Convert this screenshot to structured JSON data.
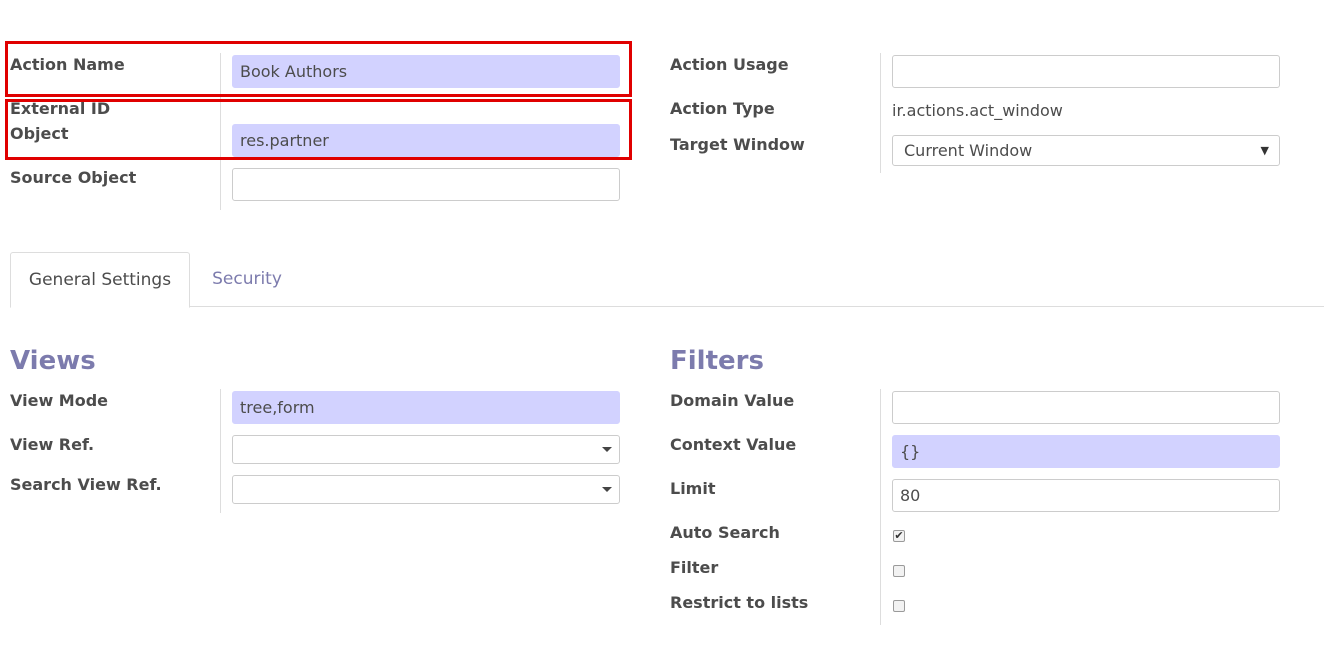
{
  "left_form": {
    "action_name_label": "Action Name",
    "action_name_value": "Book Authors",
    "external_id_label": "External ID",
    "object_label": "Object",
    "object_value": "res.partner",
    "source_object_label": "Source Object",
    "source_object_value": ""
  },
  "right_form": {
    "action_usage_label": "Action Usage",
    "action_usage_value": "",
    "action_type_label": "Action Type",
    "action_type_value": "ir.actions.act_window",
    "target_window_label": "Target Window",
    "target_window_value": "Current Window",
    "target_window_caret": "▼"
  },
  "tabs": [
    {
      "label": "General Settings",
      "active": true
    },
    {
      "label": "Security",
      "active": false
    }
  ],
  "views": {
    "title": "Views",
    "view_mode_label": "View Mode",
    "view_mode_value": "tree,form",
    "view_ref_label": "View Ref.",
    "view_ref_value": "",
    "search_view_ref_label": "Search View Ref.",
    "search_view_ref_value": ""
  },
  "filters": {
    "title": "Filters",
    "domain_value_label": "Domain Value",
    "domain_value": "",
    "context_value_label": "Context Value",
    "context_value": "{}",
    "limit_label": "Limit",
    "limit_value": "80",
    "auto_search_label": "Auto Search",
    "auto_search_checked": true,
    "auto_search_mark": "✔",
    "filter_label": "Filter",
    "filter_checked": false,
    "restrict_label": "Restrict to lists",
    "restrict_checked": false
  },
  "colors": {
    "required_field_bg": "#d2d2ff",
    "highlight_box": "#e00000",
    "section_title": "#7c7bad"
  }
}
